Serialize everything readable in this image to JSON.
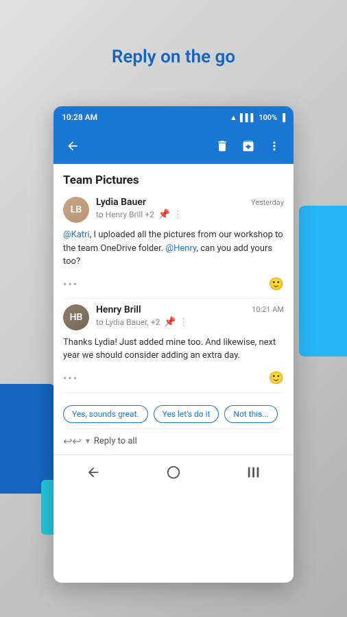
{
  "page": {
    "title": "Reply on the go"
  },
  "status_bar": {
    "time": "10:28 AM",
    "battery": "100%"
  },
  "toolbar": {
    "back_label": "‹",
    "delete_label": "🗑",
    "archive_label": "⬜",
    "more_label": "⋮"
  },
  "conversation": {
    "title": "Team Pictures",
    "emails": [
      {
        "sender": "Lydia Bauer",
        "avatar_initials": "LB",
        "recipient_text": "to Henry Brill +2",
        "time": "Yesterday",
        "body_parts": [
          {
            "type": "mention",
            "text": "@Katri"
          },
          {
            "type": "text",
            "text": ", I uploaded all the pictures from our workshop to the team OneDrive folder. "
          },
          {
            "type": "mention",
            "text": "@Henry"
          },
          {
            "type": "text",
            "text": ", can you add yours too?"
          }
        ],
        "more_dots": "•••",
        "emoji": "🙂"
      },
      {
        "sender": "Henry Brill",
        "avatar_initials": "HB",
        "recipient_text": "to Lydia Bauer, +2",
        "time": "10:21 AM",
        "body_parts": [
          {
            "type": "text",
            "text": "Thanks Lydia! Just added mine too. And likewise, next year we should consider adding an extra day."
          }
        ],
        "more_dots": "•••",
        "emoji": "🙂"
      }
    ],
    "reply_suggestions": [
      "Yes, sounds great.",
      "Yes let's do it",
      "Not this..."
    ],
    "reply_bar": {
      "icon": "↩↩",
      "chevron": "▾",
      "text": "Reply to all"
    }
  },
  "bottom_nav": {
    "back": "‹",
    "home": "○",
    "recents": "|||"
  }
}
